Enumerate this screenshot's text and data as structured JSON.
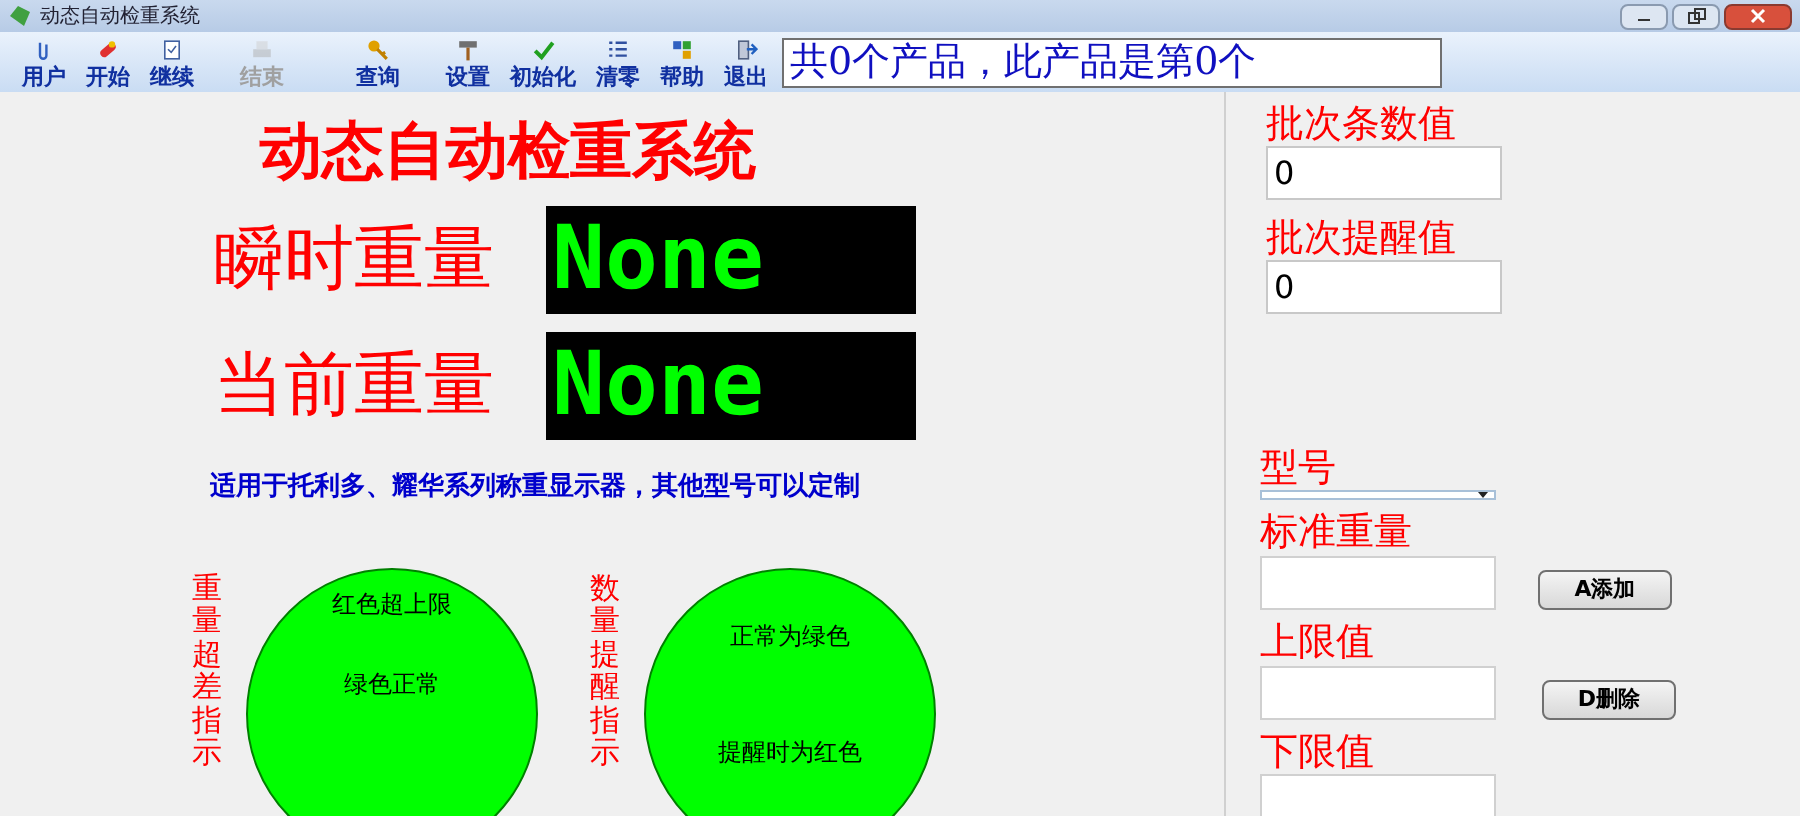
{
  "window": {
    "title": "动态自动检重系统"
  },
  "toolbar": [
    {
      "label": "用户",
      "kind": "clip",
      "disabled": false
    },
    {
      "label": "开始",
      "kind": "pill",
      "disabled": false
    },
    {
      "label": "继续",
      "kind": "doc",
      "disabled": false
    },
    {
      "label": "结束",
      "kind": "printer",
      "disabled": true
    },
    {
      "label": "查询",
      "kind": "key",
      "disabled": false
    },
    {
      "label": "设置",
      "kind": "hammer",
      "disabled": false
    },
    {
      "label": "初始化",
      "kind": "check",
      "disabled": false
    },
    {
      "label": "清零",
      "kind": "list",
      "disabled": false
    },
    {
      "label": "帮助",
      "kind": "blocks",
      "disabled": false
    },
    {
      "label": "退出",
      "kind": "exit",
      "disabled": false
    }
  ],
  "status_text": "共0个产品，此产品是第0个",
  "title": "动态自动检重系统",
  "readouts": [
    {
      "label": "瞬时重量",
      "value": "None"
    },
    {
      "label": "当前重量",
      "value": "None"
    }
  ],
  "note": "适用于托利多、耀华系列称重显示器，其他型号可以定制",
  "indicators": [
    {
      "label": "重量超差指示",
      "lines": [
        "红色超上限",
        "绿色正常"
      ]
    },
    {
      "label": "数量提醒指示",
      "lines": [
        "正常为绿色",
        "提醒时为红色"
      ]
    }
  ],
  "batch_fields": [
    {
      "label": "批次条数值",
      "value": "0"
    },
    {
      "label": "批次提醒值",
      "value": "0"
    }
  ],
  "model": {
    "label": "型号"
  },
  "weight_fields": [
    {
      "label": "标准重量",
      "button": "A添加"
    },
    {
      "label": "上限值",
      "button": "D删除"
    },
    {
      "label": "下限值"
    }
  ]
}
